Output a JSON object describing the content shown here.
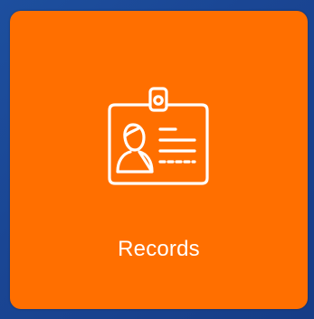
{
  "tile": {
    "label": "Records",
    "icon": "id-badge-icon",
    "background_color": "#ff6f00",
    "icon_color": "#ffffff"
  },
  "desktop": {
    "background_color": "#1a4694"
  }
}
